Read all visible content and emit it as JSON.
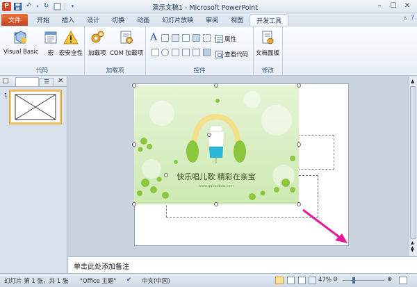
{
  "window": {
    "title": "演示文稿1 - Microsoft PowerPoint"
  },
  "tabs": [
    {
      "label": "文件"
    },
    {
      "label": "开始"
    },
    {
      "label": "插入"
    },
    {
      "label": "设计"
    },
    {
      "label": "切换"
    },
    {
      "label": "动画"
    },
    {
      "label": "幻灯片放映"
    },
    {
      "label": "审阅"
    },
    {
      "label": "视图"
    },
    {
      "label": "开发工具"
    }
  ],
  "ribbon": {
    "code": {
      "label": "代码",
      "visual_basic": "Visual Basic",
      "macro": "宏",
      "macro_security": "宏安全性"
    },
    "addins": {
      "label": "加载项",
      "addins": "加载项",
      "com_addins": "COM 加载项"
    },
    "controls": {
      "label": "控件",
      "properties": "属性",
      "view_code": "查看代码"
    },
    "modify": {
      "label": "修改",
      "document_panel": "文档面板"
    }
  },
  "slide_panel": {
    "slide_number": "1"
  },
  "slide": {
    "picture_text": "快乐唱儿歌   精彩在亲宝",
    "picture_url": "www.qqbaobao.com"
  },
  "notes": {
    "placeholder": "单击此处添加备注"
  },
  "status": {
    "slide_info": "幻灯片 第 1 张，共 1 张",
    "theme": "\"Office 主题\"",
    "language": "中文(中国)",
    "zoom": "47%"
  },
  "colors": {
    "file_tab": "#d24726",
    "arrow": "#e6189a",
    "picture_bg": "#d8efc3",
    "accent_green": "#8cc63f",
    "bottle_blue": "#2bb5d8"
  }
}
